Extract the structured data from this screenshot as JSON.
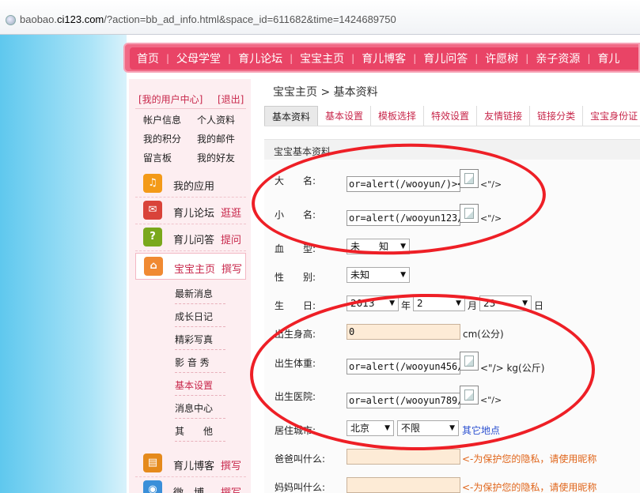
{
  "address": {
    "host_pre": "baobao.",
    "host_main": "ci123.com",
    "path": "/?action=bb_ad_info.html&space_id=611682&time=1424689750"
  },
  "nav": [
    "首页",
    "父母学堂",
    "育儿论坛",
    "宝宝主页",
    "育儿博客",
    "育儿问答",
    "许愿树",
    "亲子资源",
    "育儿"
  ],
  "sidebar": {
    "user_center": "[我的用户中心]",
    "logout": "[退出]",
    "links": [
      "帐户信息",
      "个人资料",
      "我的积分",
      "我的邮件",
      "留言板",
      "我的好友"
    ],
    "rows": [
      {
        "label": "我的应用",
        "action": "",
        "icon": "headphones-icon",
        "color": "#f39a18",
        "glyph": "♫"
      },
      {
        "label": "育儿论坛",
        "action": "逛逛",
        "icon": "chat-icon",
        "color": "#d9433a",
        "glyph": "✉"
      },
      {
        "label": "育儿问答",
        "action": "提问",
        "icon": "question-icon",
        "color": "#7aa81c",
        "glyph": "?"
      },
      {
        "label": "宝宝主页",
        "action": "撰写",
        "icon": "home-icon",
        "color": "#f08a32",
        "glyph": "⌂"
      }
    ],
    "submenu": [
      "最新消息",
      "成长日记",
      "精彩写真",
      "影 音 秀",
      "基本设置",
      "消息中心",
      "其　　他"
    ],
    "bottom_rows": [
      {
        "label": "育儿博客",
        "action": "撰写",
        "icon": "notepad-icon",
        "color": "#e58a1c",
        "glyph": "▤"
      },
      {
        "label": "微　博",
        "action": "撰写",
        "icon": "weibo-icon",
        "color": "#3a8fd9",
        "glyph": "◉"
      }
    ]
  },
  "breadcrumb": {
    "home": "宝宝主页",
    "sep": ">",
    "current": "基本资料"
  },
  "tabs": [
    "基本资料",
    "基本设置",
    "模板选择",
    "特效设置",
    "友情链接",
    "链接分类",
    "宝宝身份证"
  ],
  "section_title": "宝宝基本资料",
  "form": {
    "big_name": {
      "label": "大　　名:",
      "value": "or=alert(/wooyun/)><",
      "tail": "<\"/>"
    },
    "small_name": {
      "label": "小　　名:",
      "value": "or=alert(/wooyun123/",
      "tail": "<\"/>"
    },
    "blood": {
      "label": "血　　型:",
      "value": "未　　知"
    },
    "gender": {
      "label": "性　　别:",
      "value": "未知"
    },
    "birthday": {
      "label": "生　　日:",
      "year": "2013",
      "year_unit": "年",
      "month": "2",
      "month_unit": "月",
      "day": "23",
      "day_unit": "日"
    },
    "height": {
      "label": "出生身高:",
      "value": "0",
      "unit": "cm(公分)"
    },
    "weight": {
      "label": "出生体重:",
      "value": "or=alert(/wooyun456/",
      "tail": "<\"/> kg(公斤)"
    },
    "hospital": {
      "label": "出生医院:",
      "value": "or=alert(/wooyun789/",
      "tail": "<\"/>"
    },
    "city": {
      "label": "居住城市:",
      "province": "北京",
      "district": "不限",
      "other": "其它地点"
    },
    "father": {
      "label": "爸爸叫什么:",
      "hint": "<-为保护您的隐私，请使用昵称"
    },
    "mother": {
      "label": "妈妈叫什么:",
      "hint": "<-为保护您的隐私，请使用昵称"
    }
  }
}
